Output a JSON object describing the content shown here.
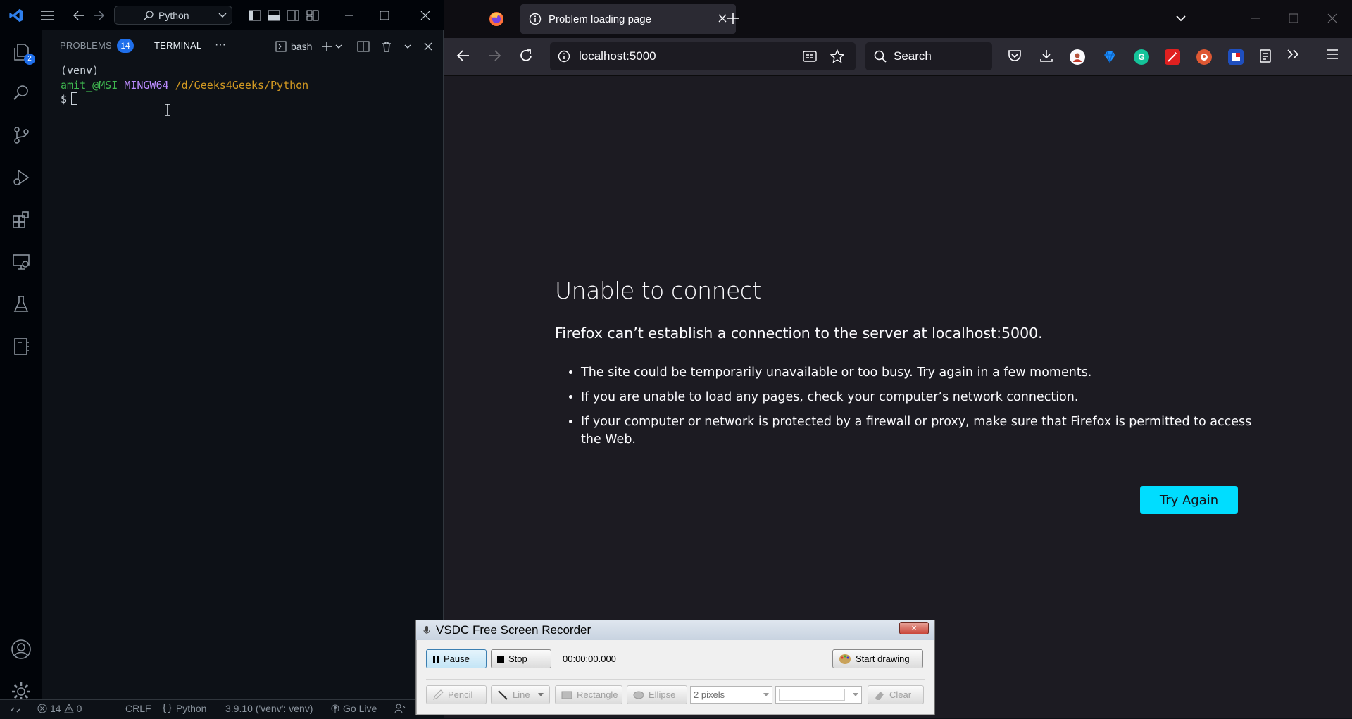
{
  "vscode": {
    "command_center": {
      "label": "Python"
    },
    "activity_badges": {
      "explorer": "2"
    },
    "panel": {
      "tabs": [
        {
          "label": "PROBLEMS",
          "count": "14"
        },
        {
          "label": "TERMINAL"
        }
      ],
      "more_label": "···",
      "shell_label": "bash"
    },
    "terminal": {
      "line1": "(venv)",
      "user": "amit_@MSI",
      "host": "MINGW64",
      "path": "/d/Geeks4Geeks/Python",
      "prompt": "$"
    },
    "statusbar": {
      "errors": "14",
      "warnings": "0",
      "eol": "CRLF",
      "language": "Python",
      "interpreter": "3.9.10 ('venv': venv)",
      "go_live": "Go Live"
    }
  },
  "firefox": {
    "tab_title": "Problem loading page",
    "url": "localhost:5000",
    "search_placeholder": "Search",
    "error": {
      "title": "Unable to connect",
      "description": "Firefox can’t establish a connection to the server at localhost:5000.",
      "bullets": [
        "The site could be temporarily unavailable or too busy. Try again in a few moments.",
        "If you are unable to load any pages, check your computer’s network connection.",
        "If your computer or network is protected by a firewall or proxy, make sure that Firefox is permitted to access the Web."
      ],
      "button": "Try Again"
    },
    "accent_color": "#00ddff"
  },
  "recorder": {
    "title": "VSDC Free Screen Recorder",
    "close_label": "×",
    "pause_label": "Pause",
    "stop_label": "Stop",
    "timer": "00:00:00.000",
    "start_drawing_label": "Start drawing",
    "tools": {
      "pencil": "Pencil",
      "line": "Line",
      "rectangle": "Rectangle",
      "ellipse": "Ellipse",
      "thickness": "2 pixels",
      "clear": "Clear"
    }
  }
}
